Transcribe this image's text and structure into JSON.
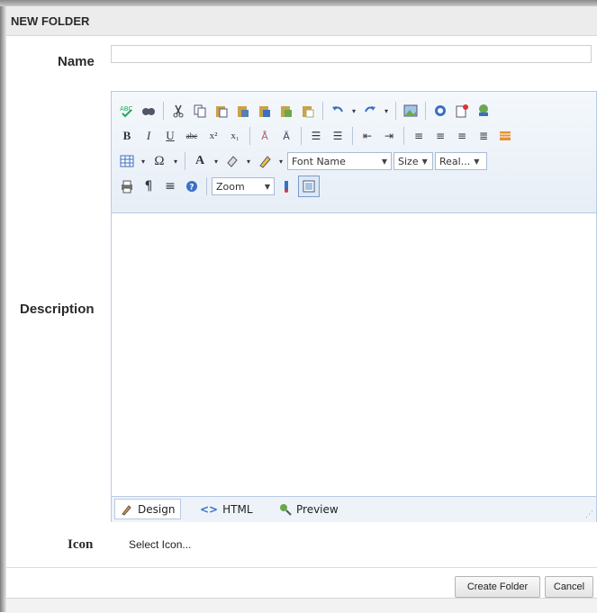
{
  "dialog": {
    "title": "NEW FOLDER"
  },
  "form": {
    "name_label": "Name",
    "name_value": "",
    "description_label": "Description",
    "icon_label": "Icon",
    "icon_link": "Select Icon..."
  },
  "editor": {
    "font_name": "Font Name",
    "size": "Size",
    "real": "Real...",
    "zoom": "Zoom",
    "modes": [
      "Design",
      "HTML",
      "Preview"
    ],
    "active_mode": "Design",
    "toolbar_icons": {
      "row1": [
        "spellcheck-icon",
        "find-icon",
        "cut-icon",
        "copy-icon",
        "paste-icon",
        "paste-text-icon",
        "paste-word-icon",
        "paste-html-icon",
        "paste-plain-icon",
        "undo-icon",
        "redo-icon",
        "image-icon",
        "media-icon",
        "document-icon",
        "link-icon"
      ],
      "row2": [
        "bold-icon",
        "italic-icon",
        "underline-icon",
        "strikethrough-icon",
        "superscript-icon",
        "subscript-icon",
        "format-stripper-icon",
        "case-icon",
        "ordered-list-icon",
        "unordered-list-icon",
        "outdent-icon",
        "indent-icon",
        "align-left-icon",
        "align-center-icon",
        "align-right-icon",
        "justify-icon",
        "style-icon"
      ],
      "row3": [
        "table-icon",
        "symbol-icon",
        "font-color-icon",
        "highlight-icon",
        "style-builder-icon"
      ],
      "row4": [
        "print-icon",
        "paragraph-icon",
        "horizontal-rule-icon",
        "help-icon",
        "zoom-icon",
        "track-icon",
        "fullscreen-icon"
      ]
    }
  },
  "buttons": {
    "create": "Create Folder",
    "cancel": "Cancel"
  }
}
